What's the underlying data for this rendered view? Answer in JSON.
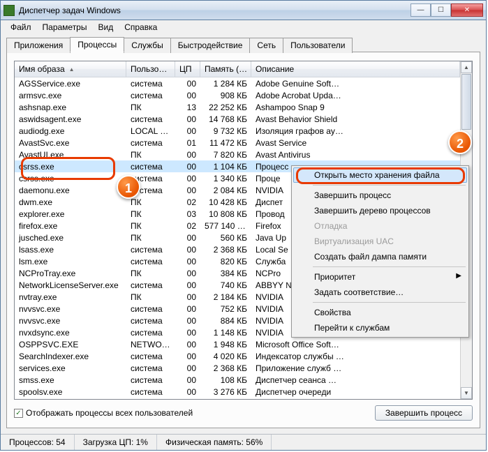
{
  "window": {
    "title": "Диспетчер задач Windows"
  },
  "menubar": [
    "Файл",
    "Параметры",
    "Вид",
    "Справка"
  ],
  "tabs": [
    {
      "label": "Приложения"
    },
    {
      "label": "Процессы"
    },
    {
      "label": "Службы"
    },
    {
      "label": "Быстродействие"
    },
    {
      "label": "Сеть"
    },
    {
      "label": "Пользователи"
    }
  ],
  "active_tab": 1,
  "columns": [
    "Имя образа",
    "Пользо…",
    "ЦП",
    "Память (…",
    "Описание"
  ],
  "rows": [
    {
      "name": "AGSService.exe",
      "user": "система",
      "cpu": "00",
      "mem": "1 284 КБ",
      "desc": "Adobe Genuine Soft…",
      "selected": false
    },
    {
      "name": "armsvc.exe",
      "user": "система",
      "cpu": "00",
      "mem": "908 КБ",
      "desc": "Adobe Acrobat Upda…",
      "selected": false
    },
    {
      "name": "ashsnap.exe",
      "user": "ПК",
      "cpu": "13",
      "mem": "22 252 КБ",
      "desc": "Ashampoo Snap 9",
      "selected": false
    },
    {
      "name": "aswidsagent.exe",
      "user": "система",
      "cpu": "00",
      "mem": "14 768 КБ",
      "desc": "Avast Behavior Shield",
      "selected": false
    },
    {
      "name": "audiodg.exe",
      "user": "LOCAL …",
      "cpu": "00",
      "mem": "9 732 КБ",
      "desc": "Изоляция графов ау…",
      "selected": false
    },
    {
      "name": "AvastSvc.exe",
      "user": "система",
      "cpu": "01",
      "mem": "11 472 КБ",
      "desc": "Avast Service",
      "selected": false
    },
    {
      "name": "AvastUI.exe",
      "user": "ПК",
      "cpu": "00",
      "mem": "7 820 КБ",
      "desc": "Avast Antivirus",
      "selected": false
    },
    {
      "name": "csrss.exe",
      "user": "система",
      "cpu": "00",
      "mem": "1 104 КБ",
      "desc": "Процесс",
      "selected": true
    },
    {
      "name": "csrss.exe",
      "user": "система",
      "cpu": "00",
      "mem": "1 340 КБ",
      "desc": "Проце",
      "selected": false
    },
    {
      "name": "daemonu.exe",
      "user": "система",
      "cpu": "00",
      "mem": "2 084 КБ",
      "desc": "NVIDIA",
      "selected": false
    },
    {
      "name": "dwm.exe",
      "user": "ПК",
      "cpu": "02",
      "mem": "10 428 КБ",
      "desc": "Диспет",
      "selected": false
    },
    {
      "name": "explorer.exe",
      "user": "ПК",
      "cpu": "03",
      "mem": "10 808 КБ",
      "desc": "Провод",
      "selected": false
    },
    {
      "name": "firefox.exe",
      "user": "ПК",
      "cpu": "02",
      "mem": "577 140 КБ",
      "desc": "Firefox",
      "selected": false
    },
    {
      "name": "jusched.exe",
      "user": "ПК",
      "cpu": "00",
      "mem": "560 КБ",
      "desc": "Java Up",
      "selected": false
    },
    {
      "name": "lsass.exe",
      "user": "система",
      "cpu": "00",
      "mem": "2 368 КБ",
      "desc": "Local Se",
      "selected": false
    },
    {
      "name": "lsm.exe",
      "user": "система",
      "cpu": "00",
      "mem": "820 КБ",
      "desc": "Служба",
      "selected": false
    },
    {
      "name": "NCProTray.exe",
      "user": "ПК",
      "cpu": "00",
      "mem": "384 КБ",
      "desc": "NCPro",
      "selected": false
    },
    {
      "name": "NetworkLicenseServer.exe",
      "user": "система",
      "cpu": "00",
      "mem": "740 КБ",
      "desc": "ABBYY №",
      "selected": false
    },
    {
      "name": "nvtray.exe",
      "user": "ПК",
      "cpu": "00",
      "mem": "2 184 КБ",
      "desc": "NVIDIA",
      "selected": false
    },
    {
      "name": "nvvsvc.exe",
      "user": "система",
      "cpu": "00",
      "mem": "752 КБ",
      "desc": "NVIDIA",
      "selected": false
    },
    {
      "name": "nvvsvc.exe",
      "user": "система",
      "cpu": "00",
      "mem": "884 КБ",
      "desc": "NVIDIA",
      "selected": false
    },
    {
      "name": "nvxdsync.exe",
      "user": "система",
      "cpu": "00",
      "mem": "1 148 КБ",
      "desc": "NVIDIA",
      "selected": false
    },
    {
      "name": "OSPPSVC.EXE",
      "user": "NETWO…",
      "cpu": "00",
      "mem": "1 948 КБ",
      "desc": "Microsoft Office Soft…",
      "selected": false
    },
    {
      "name": "SearchIndexer.exe",
      "user": "система",
      "cpu": "00",
      "mem": "4 020 КБ",
      "desc": "Индексатор службы …",
      "selected": false
    },
    {
      "name": "services.exe",
      "user": "система",
      "cpu": "00",
      "mem": "2 368 КБ",
      "desc": "Приложение служб …",
      "selected": false
    },
    {
      "name": "smss.exe",
      "user": "система",
      "cpu": "00",
      "mem": "108 КБ",
      "desc": "Диспетчер сеанса …",
      "selected": false
    },
    {
      "name": "spoolsv.exe",
      "user": "система",
      "cpu": "00",
      "mem": "3 276 КБ",
      "desc": "Диспетчер очереди",
      "selected": false
    }
  ],
  "checkbox": {
    "label": "Отображать процессы всех пользователей",
    "checked": true
  },
  "end_button": "Завершить процесс",
  "status": {
    "procs": "Процессов: 54",
    "cpu": "Загрузка ЦП: 1%",
    "mem": "Физическая память: 56%"
  },
  "context_menu": [
    {
      "label": "Открыть место хранения файла",
      "enabled": true,
      "hover": true
    },
    {
      "divider": true
    },
    {
      "label": "Завершить процесс",
      "enabled": true
    },
    {
      "label": "Завершить дерево процессов",
      "enabled": true
    },
    {
      "label": "Отладка",
      "enabled": false
    },
    {
      "label": "Виртуализация UAC",
      "enabled": false
    },
    {
      "label": "Создать файл дампа памяти",
      "enabled": true
    },
    {
      "divider": true
    },
    {
      "label": "Приоритет",
      "enabled": true,
      "submenu": true
    },
    {
      "label": "Задать соответствие…",
      "enabled": true
    },
    {
      "divider": true
    },
    {
      "label": "Свойства",
      "enabled": true
    },
    {
      "label": "Перейти к службам",
      "enabled": true
    }
  ],
  "markers": {
    "1": "1",
    "2": "2"
  }
}
